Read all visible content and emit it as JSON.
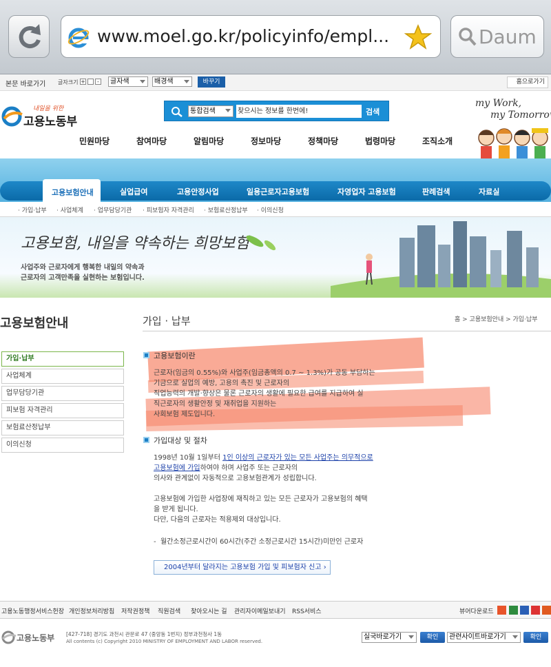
{
  "browser": {
    "url": "www.moel.go.kr/policyinfo/empl...",
    "search_placeholder": "Daum"
  },
  "util_bar": {
    "skip_link": "본문 바로가기",
    "font_size_label": "글자크기",
    "font_color_select": "글자색",
    "bg_color_select": "배경색",
    "change_button": "바꾸기",
    "home_link": "홈으로가기"
  },
  "header": {
    "logo_text": "고용노동부",
    "logo_slogan": "내일을 위한",
    "search_scope": "통합검색",
    "search_placeholder": "찾으시는 정보를 한번에!",
    "search_button": "검색",
    "tagline_line1": "my Work,",
    "tagline_line2": "my Tomorrow",
    "main_nav": [
      "민원마당",
      "참여마당",
      "알림마당",
      "정보마당",
      "정책마당",
      "법령마당",
      "조직소개"
    ]
  },
  "tabs": [
    "고용보험안내",
    "실업급여",
    "고용안정사업",
    "일용근로자고용보험",
    "자영업자 고용보험",
    "판례검색",
    "자료실"
  ],
  "subtabs": [
    "가입·납부",
    "사업체계",
    "업무담당기관",
    "피보험자 자격관리",
    "보험료산정납부",
    "이의신청"
  ],
  "banner": {
    "headline": "고용보험, 내일을 약속하는 희망보험",
    "line1": "사업주와 근로자에게 행복한 내일의 약속과",
    "line2": "근로자의 고객만족을 실현하는 보험입니다."
  },
  "sidebar": {
    "title": "고용보험안내",
    "items": [
      "가입·납부",
      "사업체계",
      "업무담당기관",
      "피보험 자격관리",
      "보험료산정납부",
      "이의신청"
    ]
  },
  "content": {
    "title": "가입 · 납부",
    "breadcrumb": [
      "홈",
      "고용보험안내",
      "가입·납부"
    ],
    "section1_title": "고용보험이란",
    "section1_lines": [
      "근로자(임금의 0.55%)와 사업주(임금총액의 0.7 ~ 1.3%)가 공동 부담하는",
      "기금으로 실업의 예방, 고용의 촉진 및 근로자의",
      "직업능력의 개발·향상은 물론 근로자의 생활에 필요한 급여를 지급하여 실",
      "직근로자의 생활안정 및 재취업을 지원하는",
      "사회보험 제도입니다."
    ],
    "section2_title": "가입대상 및 절차",
    "p1_prefix": "1998년 10월 1일부터 ",
    "p1_link_a": "1인 이상의 근로자가 있는 모든 사업주는 의무적으로",
    "p1_link_b": "고용보험에 가입",
    "p1_suffix": "하여야 하며 사업주 또는 근로자의",
    "p1_line3": "의사와 관계없이 자동적으로 고용보험관계가 성립합니다.",
    "p2_lines": [
      "고용보험에 가입한 사업장에 재직하고 있는 모든 근로자가 고용보험의 혜택",
      "을 받게 됩니다.",
      "다만, 다음의 근로자는 적용제외 대상입니다."
    ],
    "exclusion_item": "월간소정근로시간이 60시간(주간 소정근로시간 15시간)미만인 근로자",
    "link_button": "2004년부터 달라지는 고용보험 가입 및 피보험자 신고"
  },
  "footer": {
    "links": [
      "고용노동행정서비스헌장",
      "개인정보처리방침",
      "저작권정책",
      "직원검색",
      "찾아오시는 길",
      "관리자이메일보내기",
      "RSS서비스"
    ],
    "viewer_label": "뷰어다운로드",
    "logo_text": "고용노동부",
    "address": "[427-718] 경기도 과천시 관문로 47 (중앙동 1번지) 정부과천청사 1동",
    "copyright": "All contents (c) Copyright 2010 MINISTRY OF EMPLOYMENT AND LABOR reserved.",
    "select1": "실국바로가기",
    "confirm1": "확인",
    "select2": "관련사이트바로가기",
    "confirm2": "확인"
  },
  "colors": {
    "brand_blue": "#1b7fc6",
    "highlight": "#f6866a"
  }
}
